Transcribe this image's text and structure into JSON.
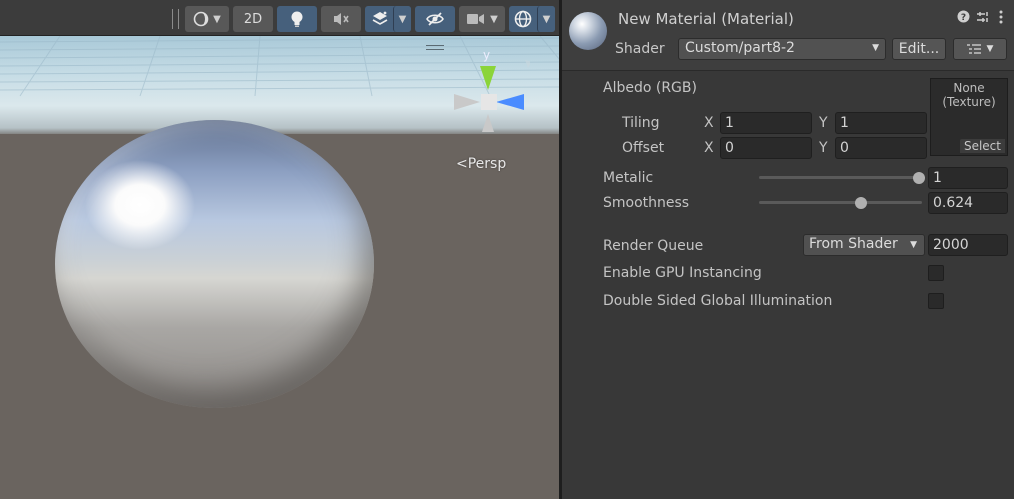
{
  "scene": {
    "toolbar": {
      "btn_2d": "2D",
      "icons": [
        "draw-mode-icon",
        "lightbulb-icon",
        "audio-icon",
        "effects-icon",
        "hidden-icon",
        "camera-icon",
        "gizmos-icon"
      ]
    },
    "gizmo": {
      "y_label": "y"
    },
    "persp_label": "Persp"
  },
  "inspector": {
    "title": "New Material (Material)",
    "shader_label": "Shader",
    "shader_value": "Custom/part8-2",
    "edit_label": "Edit...",
    "albedo_label": "Albedo (RGB)",
    "tiling_label": "Tiling",
    "offset_label": "Offset",
    "axis_x": "X",
    "axis_y": "Y",
    "tiling_x": "1",
    "tiling_y": "1",
    "offset_x": "0",
    "offset_y": "0",
    "texture_none": "None",
    "texture_type": "(Texture)",
    "texture_select": "Select",
    "metalic_label": "Metalic",
    "metalic_value": "1",
    "metalic_level": 1.0,
    "smoothness_label": "Smoothness",
    "smoothness_value": "0.624",
    "smoothness_level": 0.624,
    "render_queue_label": "Render Queue",
    "render_queue_mode": "From Shader",
    "render_queue_value": "2000",
    "gpu_instancing_label": "Enable GPU Instancing",
    "gpu_instancing_checked": false,
    "double_sided_gi_label": "Double Sided Global Illumination",
    "double_sided_gi_checked": false
  },
  "colors": {
    "toolbar_active": "#46607c",
    "gizmo_y": "#8bd43a",
    "gizmo_x": "#4a8cff"
  }
}
